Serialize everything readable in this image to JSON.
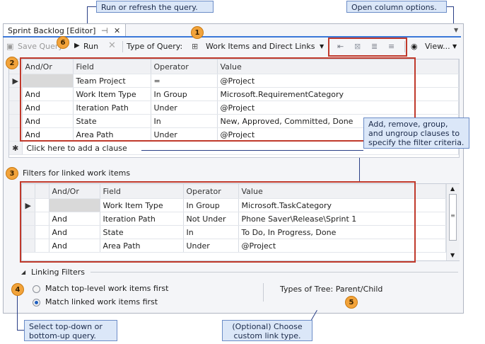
{
  "callouts": {
    "run": "Run or refresh the query.",
    "column_options": "Open column options.",
    "clauses": "Add, remove, group, and ungroup clauses to specify the filter criteria.",
    "topdown": "Select top-down or bottom-up query.",
    "linktype": "(Optional) Choose custom link type."
  },
  "badges": {
    "b1": "1",
    "b2": "2",
    "b3": "3",
    "b4": "4",
    "b5": "5",
    "b6": "6"
  },
  "tab": {
    "title": "Sprint Backlog [Editor]",
    "pin": "⊣",
    "close": "✕"
  },
  "toolbar": {
    "save": "Save Query",
    "run": "Run",
    "query_type_label": "Type of Query:",
    "query_type_value": "Work Items and Direct Links",
    "view": "View..."
  },
  "grid1": {
    "headers": [
      "And/Or",
      "Field",
      "Operator",
      "Value"
    ],
    "rows": [
      [
        "",
        "Team Project",
        "=",
        "@Project"
      ],
      [
        "And",
        "Work Item Type",
        "In Group",
        "Microsoft.RequirementCategory"
      ],
      [
        "And",
        "Iteration Path",
        "Under",
        "@Project"
      ],
      [
        "And",
        "State",
        "In",
        "New, Approved, Committed, Done"
      ],
      [
        "And",
        "Area Path",
        "Under",
        "@Project"
      ]
    ],
    "add_clause": "Click here to add a clause"
  },
  "linked_section": {
    "title": "Filters for linked work items"
  },
  "grid2": {
    "headers": [
      "And/Or",
      "Field",
      "Operator",
      "Value"
    ],
    "rows": [
      [
        "",
        "Work Item Type",
        "In Group",
        "Microsoft.TaskCategory"
      ],
      [
        "And",
        "Iteration Path",
        "Not Under",
        "Phone Saver\\Release\\Sprint 1"
      ],
      [
        "And",
        "State",
        "In",
        "To Do, In Progress, Done"
      ],
      [
        "And",
        "Area Path",
        "Under",
        "@Project"
      ]
    ]
  },
  "linking": {
    "title": "Linking Filters",
    "option1": "Match top-level work items first",
    "option2": "Match linked work items first",
    "tree_types": "Types of Tree: Parent/Child"
  }
}
